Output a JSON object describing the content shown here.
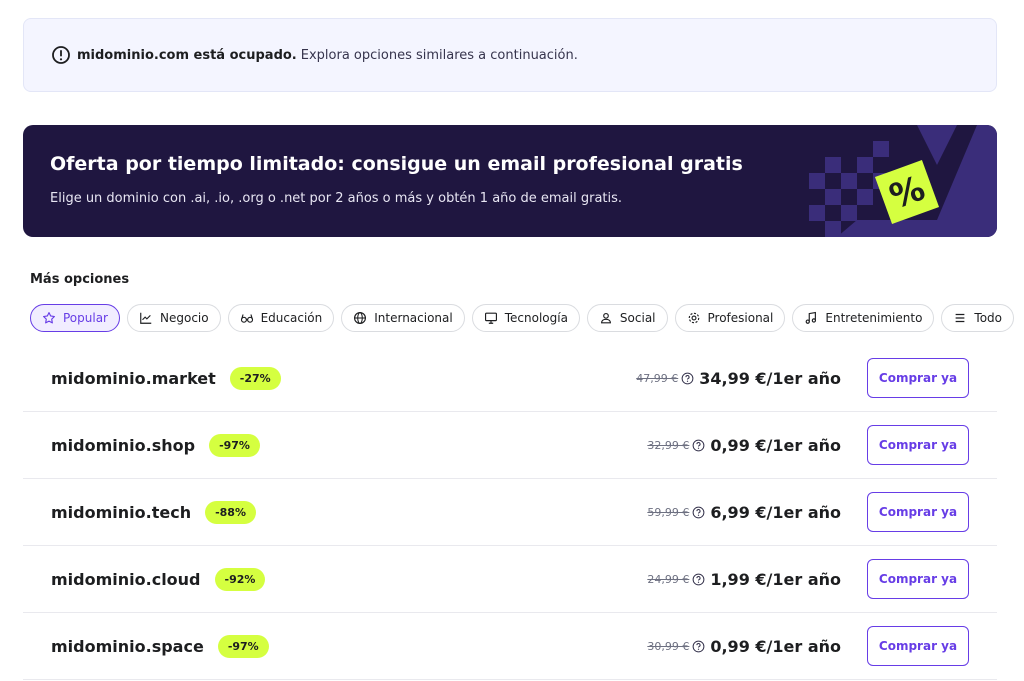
{
  "notice": {
    "domain_msg": "midominio.com está ocupado.",
    "rest": "Explora opciones similares a continuación.",
    "icon": "alert-circle-icon"
  },
  "banner": {
    "title": "Oferta por tiempo limitado: consigue un email profesional gratis",
    "subtitle": "Elige un dominio con .ai, .io, .org o .net por 2 años o más y obtén 1 año de email gratis.",
    "badge_symbol": "%",
    "colors": {
      "background": "#1f1640",
      "accent": "#d5ff40"
    }
  },
  "section_title": "Más opciones",
  "filters": [
    {
      "label": "Popular",
      "icon": "star-icon",
      "active": true
    },
    {
      "label": "Negocio",
      "icon": "chart-line-icon"
    },
    {
      "label": "Educación",
      "icon": "glasses-icon"
    },
    {
      "label": "Internacional",
      "icon": "globe-icon"
    },
    {
      "label": "Tecnología",
      "icon": "monitor-icon"
    },
    {
      "label": "Social",
      "icon": "user-icon"
    },
    {
      "label": "Profesional",
      "icon": "gear-icon"
    },
    {
      "label": "Entretenimiento",
      "icon": "music-note-icon"
    },
    {
      "label": "Todo",
      "icon": "menu-icon"
    }
  ],
  "domains": [
    {
      "name": "midominio.market",
      "discount": "-27%",
      "old_price": "47,99 €",
      "price": "34,99 €/1er año",
      "button": "Comprar ya"
    },
    {
      "name": "midominio.shop",
      "discount": "-97%",
      "old_price": "32,99 €",
      "price": "0,99 €/1er año",
      "button": "Comprar ya"
    },
    {
      "name": "midominio.tech",
      "discount": "-88%",
      "old_price": "59,99 €",
      "price": "6,99 €/1er año",
      "button": "Comprar ya"
    },
    {
      "name": "midominio.cloud",
      "discount": "-92%",
      "old_price": "24,99 €",
      "price": "1,99 €/1er año",
      "button": "Comprar ya"
    },
    {
      "name": "midominio.space",
      "discount": "-97%",
      "old_price": "30,99 €",
      "price": "0,99 €/1er año",
      "button": "Comprar ya"
    }
  ],
  "colors": {
    "primary": "#673de6",
    "discount_badge": "#d5ff40",
    "notice_bg": "#f4f5ff"
  }
}
